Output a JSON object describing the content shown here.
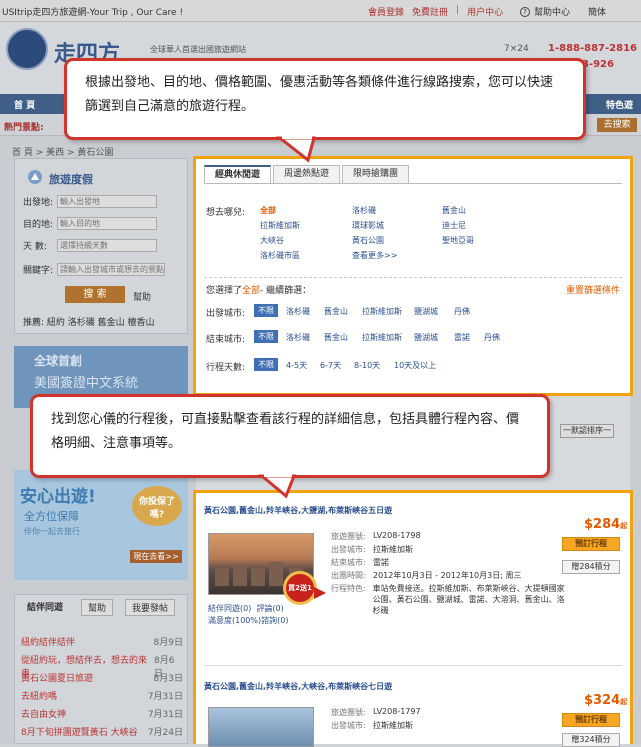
{
  "site": {
    "window_title": "USItrip走四方旅遊網-Your Trip , Our Care !",
    "top_links": [
      "會員登錄",
      "免費註冊",
      "用户中心"
    ],
    "help": "幫助中心",
    "lang": "簡体",
    "logo": "走四方",
    "slogan": "全球華人首選出國旅遊網站",
    "phone_label": "7×24",
    "phone1": "1-888-887-2816",
    "phone2": "33-926",
    "nav_home": "首 頁",
    "nav_special": "特色遊",
    "hot_label": "熱門景點:",
    "hot_search_btn": "去搜索",
    "breadcrumb": "首 頁 > 美西 > 黃石公園"
  },
  "sidebar": {
    "title": "旅遊度假",
    "from_label": "出發地:",
    "from_placeholder": "輸入出發地",
    "to_label": "目的地:",
    "to_placeholder": "輸入目的地",
    "days_label": "天  數:",
    "days_placeholder": "選擇持續天數",
    "keyword_label": "關鍵字:",
    "keyword_placeholder": "請輸入出發城市或想去的景點",
    "search_btn": "搜 索",
    "help": "幫助",
    "recommend": "推薦: 紐約  洛杉磯  舊金山  檀香山"
  },
  "ads": {
    "visa_t1": "全球首創",
    "visa_t2": "美國簽證中文系統",
    "ins_t1": "安心出遊!",
    "ins_t2": "全方位保障",
    "ins_t3": "伴你一起去旅行",
    "ins_bubble": "你投保了嗎?",
    "ins_cta": "現在去看>>"
  },
  "forum": {
    "tabs": [
      "結伴同遊",
      "幫助",
      "我要發帖"
    ],
    "items": [
      {
        "title": "紐約結伴結伴",
        "date": "8月9日"
      },
      {
        "title": "從紐約玩，想結伴去，想去的來串",
        "date": "8月6日"
      },
      {
        "title": "黃石公園夏日旅遊",
        "date": "8月3日"
      },
      {
        "title": "去紐約嗎",
        "date": "7月31日"
      },
      {
        "title": "去自由女神",
        "date": "7月31日"
      },
      {
        "title": "8月下旬拼團遊覽黃石 大峽谷",
        "date": "7月24日"
      }
    ]
  },
  "sort": "一默認排序一",
  "filters": {
    "tabs": [
      "經典休閒遊",
      "周邊熱點遊",
      "限時搶購團"
    ],
    "dest_label": "想去哪兒:",
    "destinations": [
      {
        "name": "全部",
        "selected": true
      },
      {
        "name": "洛杉磯"
      },
      {
        "name": "舊金山"
      },
      {
        "name": "拉斯維加斯"
      },
      {
        "name": "環球影城"
      },
      {
        "name": "迪士尼"
      },
      {
        "name": "大峽谷"
      },
      {
        "name": "黃石公園"
      },
      {
        "name": "聖地亞哥"
      },
      {
        "name": "洛杉磯市區"
      },
      {
        "name": "查看更多>>"
      }
    ],
    "chosen_prefix": "您選擇了",
    "chosen_value": "全部",
    "chosen_suffix": "- 繼續篩選：",
    "clear": "重置篩選條件",
    "rows": [
      {
        "label": "出發城市:",
        "options": [
          "不限",
          "洛杉磯",
          "舊金山",
          "拉斯維加斯",
          "鹽湖城",
          "丹佛"
        ]
      },
      {
        "label": "結束城市:",
        "options": [
          "不限",
          "洛杉磯",
          "舊金山",
          "拉斯維加斯",
          "鹽湖城",
          "雷諾",
          "丹佛"
        ]
      },
      {
        "label": "行程天數:",
        "options": [
          "不限",
          "4-5天",
          "6-7天",
          "8-10天",
          "10天及以上"
        ]
      }
    ]
  },
  "results": [
    {
      "title": "黃石公園,舊金山,羚羊峽谷,大鹽湖,布萊斯峽谷五日遊",
      "code_label": "旅遊團號:",
      "code": "LV208-1798",
      "from_label": "出發城市:",
      "from": "拉斯維加斯",
      "end_label": "結束城市:",
      "end": "雷諾",
      "date_label": "出團時間:",
      "date": "2012年10月3日 - 2012年10月3日; 周三",
      "feat_label": "行程特色:",
      "features": "車站免費接送。拉斯維加斯、布萊斯峽谷、大提頓國家公園、黃石公園、鹽湖城、雷諾、大溶洞、舊金山、洛杉磯",
      "price": "$284",
      "price_unit": "起",
      "book_btn": "預訂行程",
      "points_btn": "贈284積分",
      "badge": "買2送1",
      "stats_companion": "結伴同遊(0)",
      "stats_review": "評論(0)",
      "stats_satisfaction": "滿意度(100%)諮詢(0)"
    },
    {
      "title": "黃石公園,舊金山,羚羊峽谷,大峽谷,布萊斯峽谷七日遊",
      "code_label": "旅遊團號:",
      "code": "LV208-1797",
      "from_label": "出發城市:",
      "from": "拉斯維加斯",
      "price": "$324",
      "price_unit": "起",
      "book_btn": "預訂行程",
      "points_btn": "贈324積分"
    }
  ],
  "callouts": {
    "c1": "根據出發地、目的地、價格範圍、優惠活動等各類條件進行線路搜索，您可以快速篩選到自己滿意的旅遊行程。",
    "c2": "找到您心儀的行程後，可直接點擊查看該行程的詳細信息，包括具體行程內容、價格明細、注意事項等。"
  },
  "colors": {
    "highlight_border": "#f2a20e",
    "callout_border": "#d0342c",
    "link": "#2a4f8f",
    "accent": "#e35a00"
  }
}
